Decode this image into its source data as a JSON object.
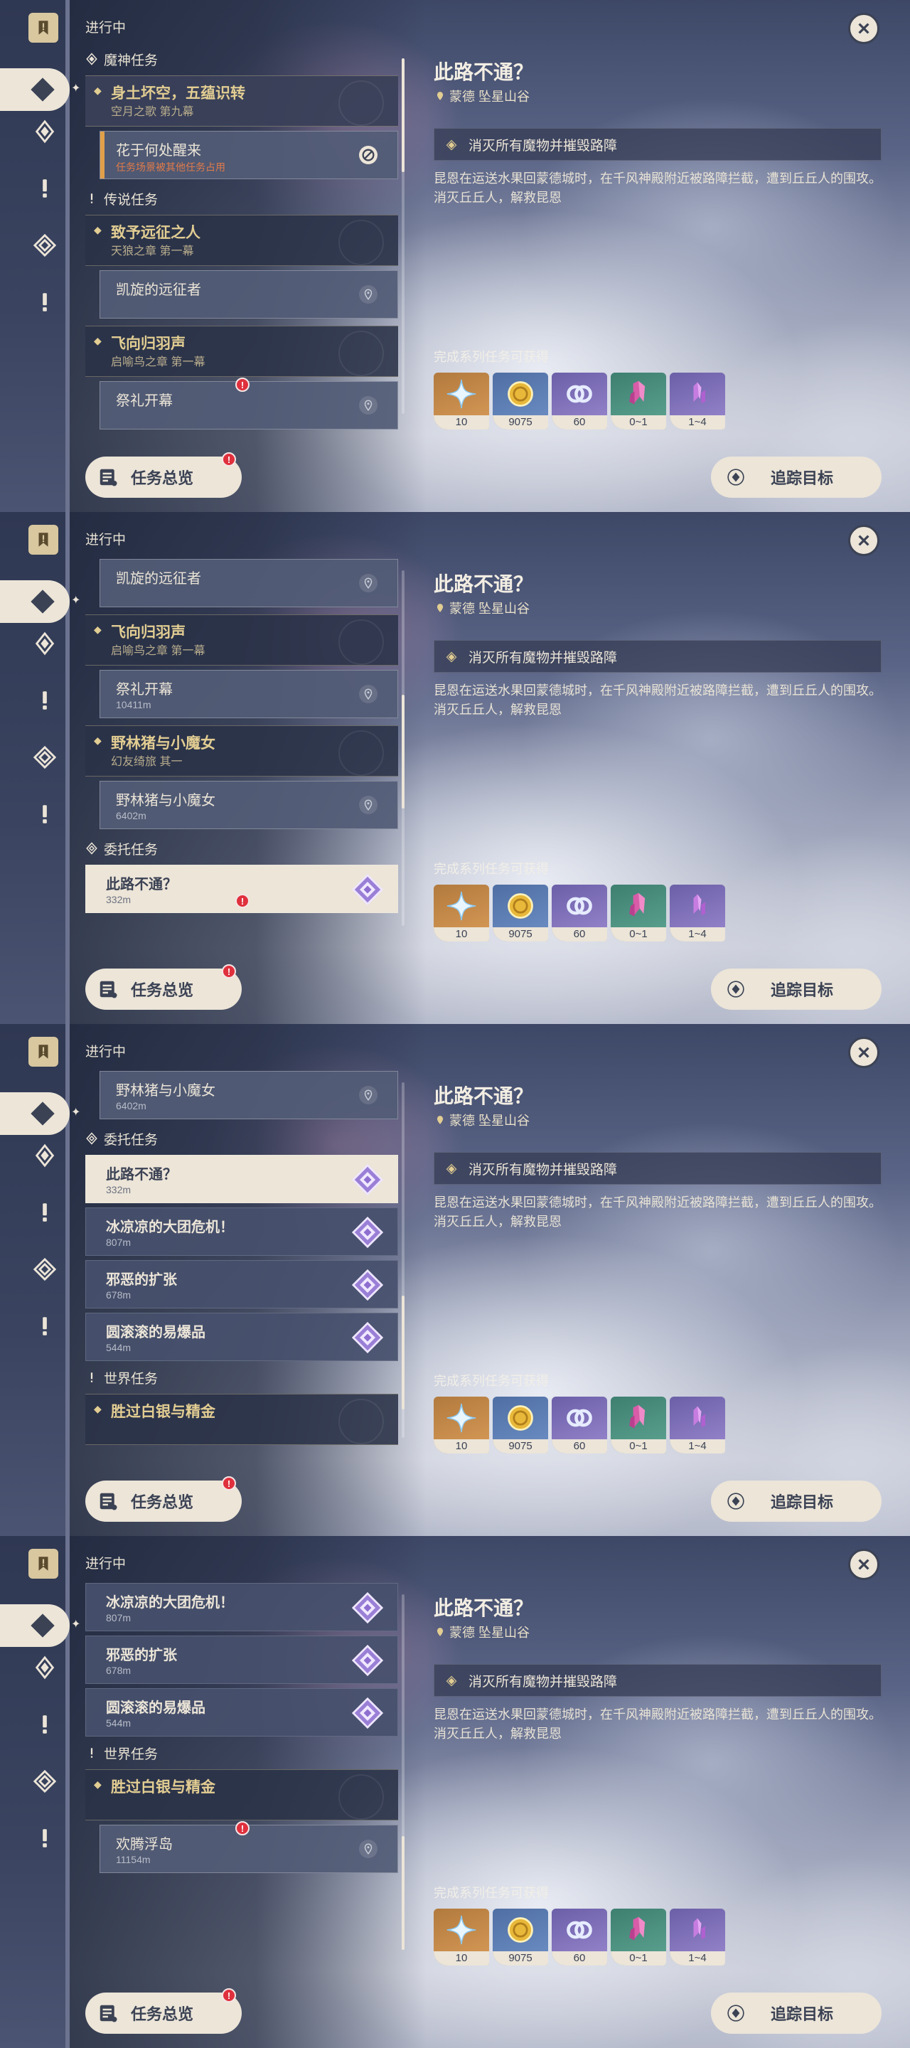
{
  "common": {
    "in_progress": "进行中",
    "close_icon": "close-icon",
    "overview_label": "任务总览",
    "track_label": "追踪目标"
  },
  "detail": {
    "title": "此路不通？",
    "location": "蒙德 坠星山谷",
    "objective": "消灭所有魔物并摧毁路障",
    "description": "昆恩在运送水果回蒙德城时，在千风神殿附近被路障拦截，遭到丘丘人的围攻。消灭丘丘人，解救昆恩",
    "rewards_label": "完成系列任务可获得",
    "rewards": [
      {
        "icon": "primogem-icon",
        "count": "10",
        "rarity": "r5"
      },
      {
        "icon": "mora-icon",
        "count": "9075",
        "rarity": "r3"
      },
      {
        "icon": "adventure-exp-icon",
        "count": "60",
        "rarity": "r4"
      },
      {
        "icon": "crystal-chunk-icon",
        "count": "0~1",
        "rarity": "r2"
      },
      {
        "icon": "crystal-fragment-icon",
        "count": "1~4",
        "rarity": "r4"
      }
    ]
  },
  "panels": [
    {
      "scroll": {
        "top": 0.0,
        "size": 0.32
      },
      "list": [
        {
          "kind": "cat",
          "icon": "archon-quest-icon",
          "text": "魔神任务"
        },
        {
          "kind": "chapter",
          "title": "身土坏空，五蕴识转",
          "subtitle": "空月之歌 第九幕",
          "selected": true
        },
        {
          "kind": "sub",
          "title": "花于何处醒来",
          "detail": "任务场景被其他任务占用",
          "blocked": true
        },
        {
          "kind": "cat",
          "icon": "legend-quest-icon",
          "text": "传说任务"
        },
        {
          "kind": "chapter",
          "title": "致予远征之人",
          "subtitle": "天狼之章 第一幕"
        },
        {
          "kind": "sub",
          "title": "凯旋的远征者",
          "detail": ""
        },
        {
          "kind": "chapter",
          "title": "飞向归羽声",
          "subtitle": "启喻鸟之章 第一幕"
        },
        {
          "kind": "sub",
          "title": "祭礼开幕",
          "detail": "",
          "alert": "!"
        }
      ]
    },
    {
      "scroll": {
        "top": 0.35,
        "size": 0.32
      },
      "list": [
        {
          "kind": "sub",
          "title": "凯旋的远征者",
          "detail": ""
        },
        {
          "kind": "chapter",
          "title": "飞向归羽声",
          "subtitle": "启喻鸟之章 第一幕"
        },
        {
          "kind": "sub",
          "title": "祭礼开幕",
          "detail": "10411m"
        },
        {
          "kind": "chapter",
          "title": "野林猪与小魔女",
          "subtitle": "幻友绮旅 其一"
        },
        {
          "kind": "sub",
          "title": "野林猪与小魔女",
          "detail": "6402m"
        },
        {
          "kind": "cat",
          "icon": "commission-icon",
          "text": "委托任务"
        },
        {
          "kind": "comm",
          "title": "此路不通？",
          "detail": "332m",
          "selected": true,
          "alert": "!"
        }
      ]
    },
    {
      "scroll": {
        "top": 0.6,
        "size": 0.32
      },
      "list": [
        {
          "kind": "sub",
          "title": "野林猪与小魔女",
          "detail": "6402m"
        },
        {
          "kind": "cat",
          "icon": "commission-icon",
          "text": "委托任务"
        },
        {
          "kind": "comm",
          "title": "此路不通？",
          "detail": "332m",
          "selected": true
        },
        {
          "kind": "comm",
          "title": "冰凉凉的大团危机！",
          "detail": "807m"
        },
        {
          "kind": "comm",
          "title": "邪恶的扩张",
          "detail": "678m"
        },
        {
          "kind": "comm",
          "title": "圆滚滚的易爆品",
          "detail": "544m"
        },
        {
          "kind": "cat",
          "icon": "world-quest-icon",
          "text": "世界任务"
        },
        {
          "kind": "chapter",
          "title": "胜过白银与精金",
          "subtitle": ""
        }
      ]
    },
    {
      "scroll": {
        "top": 0.68,
        "size": 0.32
      },
      "list": [
        {
          "kind": "comm",
          "title": "冰凉凉的大团危机！",
          "detail": "807m"
        },
        {
          "kind": "comm",
          "title": "邪恶的扩张",
          "detail": "678m"
        },
        {
          "kind": "comm",
          "title": "圆滚滚的易爆品",
          "detail": "544m"
        },
        {
          "kind": "cat",
          "icon": "world-quest-icon",
          "text": "世界任务"
        },
        {
          "kind": "chapter",
          "title": "胜过白银与精金",
          "subtitle": ""
        },
        {
          "kind": "sub",
          "title": "欢腾浮岛",
          "detail": "11154m",
          "alert": "!"
        }
      ]
    }
  ]
}
